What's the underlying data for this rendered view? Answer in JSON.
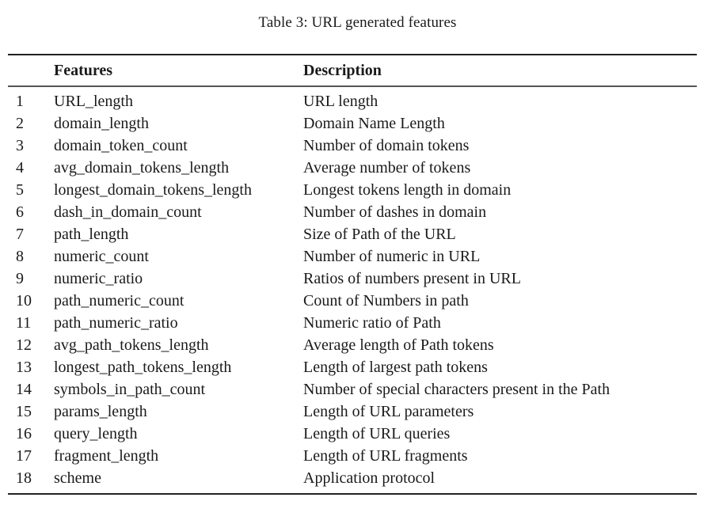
{
  "caption": "Table 3: URL generated features",
  "table": {
    "headers": {
      "index": "",
      "features": "Features",
      "description": "Description"
    },
    "rows": [
      {
        "index": "1",
        "feature": "URL_length",
        "description": "URL length"
      },
      {
        "index": "2",
        "feature": "domain_length",
        "description": "Domain Name Length"
      },
      {
        "index": "3",
        "feature": "domain_token_count",
        "description": "Number of domain tokens"
      },
      {
        "index": "4",
        "feature": "avg_domain_tokens_length",
        "description": "Average number of tokens"
      },
      {
        "index": "5",
        "feature": "longest_domain_tokens_length",
        "description": "Longest tokens length in domain"
      },
      {
        "index": "6",
        "feature": "dash_in_domain_count",
        "description": "Number of dashes in domain"
      },
      {
        "index": "7",
        "feature": "path_length",
        "description": "Size of Path of the URL"
      },
      {
        "index": "8",
        "feature": "numeric_count",
        "description": "Number of numeric in URL"
      },
      {
        "index": "9",
        "feature": "numeric_ratio",
        "description": "Ratios of numbers present in URL"
      },
      {
        "index": "10",
        "feature": "path_numeric_count",
        "description": "Count of Numbers in path"
      },
      {
        "index": "11",
        "feature": "path_numeric_ratio",
        "description": "Numeric ratio of Path"
      },
      {
        "index": "12",
        "feature": "avg_path_tokens_length",
        "description": "Average length of Path tokens"
      },
      {
        "index": "13",
        "feature": "longest_path_tokens_length",
        "description": "Length of largest path tokens"
      },
      {
        "index": "14",
        "feature": "symbols_in_path_count",
        "description": "Number of special characters present in the Path"
      },
      {
        "index": "15",
        "feature": "params_length",
        "description": "Length of URL parameters"
      },
      {
        "index": "16",
        "feature": "query_length",
        "description": "Length of URL queries"
      },
      {
        "index": "17",
        "feature": "fragment_length",
        "description": "Length of URL fragments"
      },
      {
        "index": "18",
        "feature": "scheme",
        "description": "Application protocol"
      }
    ]
  }
}
